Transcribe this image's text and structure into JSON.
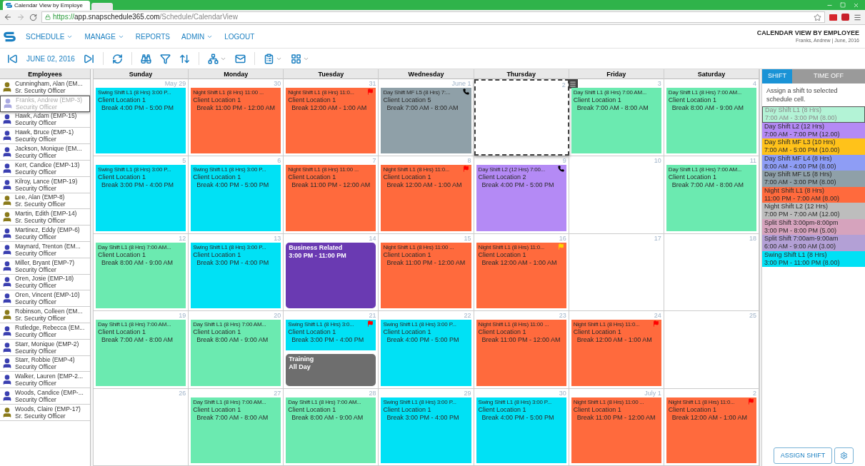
{
  "browser": {
    "tab_title": "Calendar View by Employe",
    "url_scheme": "https://",
    "url_host": "app.snapschedule365.com",
    "url_path": "/Schedule/CalendarView"
  },
  "nav": {
    "menu": [
      {
        "label": "SCHEDULE",
        "dropdown": true
      },
      {
        "label": "MANAGE",
        "dropdown": true
      },
      {
        "label": "REPORTS",
        "dropdown": false
      },
      {
        "label": "ADMIN",
        "dropdown": true
      },
      {
        "label": "LOGOUT",
        "dropdown": false
      }
    ],
    "page_title": "CALENDAR VIEW BY EMPLOYEE",
    "page_subtitle": "Franks, Andrew | June, 2016"
  },
  "toolbar": {
    "date": "JUNE 02, 2016"
  },
  "employees": {
    "title": "Employees",
    "items": [
      {
        "name": "Cunningham, Alan (EM...",
        "role": "Sr. Security Officer",
        "color": "#8a7a1a",
        "selected": false
      },
      {
        "name": "Franks, Andrew (EMP-3)",
        "role": "Security Officer",
        "color": "#a9a9e0",
        "selected": true
      },
      {
        "name": "Hawk, Adam (EMP-15)",
        "role": "Security Officer",
        "color": "#3a3fb0",
        "selected": false
      },
      {
        "name": "Hawk, Bruce (EMP-1)",
        "role": "Security Officer",
        "color": "#3a3fb0",
        "selected": false
      },
      {
        "name": "Jackson, Monique (EM...",
        "role": "Security Officer",
        "color": "#3a3fb0",
        "selected": false
      },
      {
        "name": "Kerr, Candice (EMP-13)",
        "role": "Security Officer",
        "color": "#3a3fb0",
        "selected": false
      },
      {
        "name": "Kilroy, Lance (EMP-19)",
        "role": "Security Officer",
        "color": "#3a3fb0",
        "selected": false
      },
      {
        "name": "Lee, Alan (EMP-8)",
        "role": "Sr. Security Officer",
        "color": "#8a7a1a",
        "selected": false
      },
      {
        "name": "Martin, Edith (EMP-14)",
        "role": "Sr. Security Officer",
        "color": "#8a7a1a",
        "selected": false
      },
      {
        "name": "Martinez, Eddy (EMP-6)",
        "role": "Security Officer",
        "color": "#3a3fb0",
        "selected": false
      },
      {
        "name": "Maynard, Trenton (EM...",
        "role": "Security Officer",
        "color": "#3a3fb0",
        "selected": false
      },
      {
        "name": "Miller, Bryant (EMP-7)",
        "role": "Security Officer",
        "color": "#3a3fb0",
        "selected": false
      },
      {
        "name": "Oren, Josie (EMP-18)",
        "role": "Security Officer",
        "color": "#3a3fb0",
        "selected": false
      },
      {
        "name": "Oren, Vincent (EMP-10)",
        "role": "Security Officer",
        "color": "#3a3fb0",
        "selected": false
      },
      {
        "name": "Robinson, Colleen (EM...",
        "role": "Sr. Security Officer",
        "color": "#8a7a1a",
        "selected": false
      },
      {
        "name": "Rutledge, Rebecca (EM...",
        "role": "Security Officer",
        "color": "#3a3fb0",
        "selected": false
      },
      {
        "name": "Starr, Monique (EMP-2)",
        "role": "Security Officer",
        "color": "#3a3fb0",
        "selected": false
      },
      {
        "name": "Starr, Robbie (EMP-4)",
        "role": "Security Officer",
        "color": "#3a3fb0",
        "selected": false
      },
      {
        "name": "Walker, Lauren (EMP-2...",
        "role": "Security Officer",
        "color": "#3a3fb0",
        "selected": false
      },
      {
        "name": "Woods, Candice (EMP-...",
        "role": "Security Officer",
        "color": "#3a3fb0",
        "selected": false
      },
      {
        "name": "Woods, Claire (EMP-17)",
        "role": "Sr. Security Officer",
        "color": "#8a7a1a",
        "selected": false
      }
    ]
  },
  "calendar": {
    "weekdays": [
      "Sunday",
      "Monday",
      "Tuesday",
      "Wednesday",
      "Thursday",
      "Friday",
      "Saturday"
    ],
    "weeks": [
      [
        {
          "date": "May 29",
          "selected": false,
          "events": [
            {
              "kind": "shift",
              "color": "#00e1f5",
              "title": "Swing Shift L1 (8 Hrs) 3:00 P...",
              "location": "Client Location 1",
              "break": "Break 4:00 PM - 5:00 PM"
            }
          ]
        },
        {
          "date": "30",
          "selected": false,
          "events": [
            {
              "kind": "shift",
              "color": "#ff6a3d",
              "title": "Night Shift L1 (8 Hrs) 11:00 ...",
              "location": "Client Location 1",
              "break": "Break 11:00 PM - 12:00 AM"
            }
          ]
        },
        {
          "date": "31",
          "selected": false,
          "events": [
            {
              "kind": "shift",
              "color": "#ff6a3d",
              "title": "Night Shift L1 (8 Hrs) 11:0...",
              "location": "Client Location 1",
              "break": "Break 12:00 AM - 1:00 AM",
              "marker": {
                "kind": "flag",
                "color": "#ff0000"
              }
            }
          ]
        },
        {
          "date": "June 1",
          "selected": false,
          "events": [
            {
              "kind": "shift",
              "color": "#8fa0a8",
              "title": "Day Shift MF L5 (8 Hrs) 7:...",
              "location": "Client Location 5",
              "break": "Break 7:00 AM - 8:00 AM",
              "marker": {
                "kind": "phone"
              }
            }
          ]
        },
        {
          "date": "2",
          "selected": true
        },
        {
          "date": "3",
          "selected": false,
          "events": [
            {
              "kind": "shift",
              "color": "#6beab0",
              "title": "Day Shift L1 (8 Hrs) 7:00 AM...",
              "location": "Client Location 1",
              "break": "Break 7:00 AM - 8:00 AM"
            }
          ]
        },
        {
          "date": "4",
          "selected": false,
          "events": [
            {
              "kind": "shift",
              "color": "#6beab0",
              "title": "Day Shift L1 (8 Hrs) 7:00 AM...",
              "location": "Client Location 1",
              "break": "Break 8:00 AM - 9:00 AM"
            }
          ]
        }
      ],
      [
        {
          "date": "5",
          "selected": false,
          "events": [
            {
              "kind": "shift",
              "color": "#00e1f5",
              "title": "Swing Shift L1 (8 Hrs) 3:00 P...",
              "location": "Client Location 1",
              "break": "Break 3:00 PM - 4:00 PM"
            }
          ]
        },
        {
          "date": "6",
          "selected": false,
          "events": [
            {
              "kind": "shift",
              "color": "#00e1f5",
              "title": "Swing Shift L1 (8 Hrs) 3:00 P...",
              "location": "Client Location 1",
              "break": "Break 4:00 PM - 5:00 PM"
            }
          ]
        },
        {
          "date": "7",
          "selected": false,
          "events": [
            {
              "kind": "shift",
              "color": "#ff6a3d",
              "title": "Night Shift L1 (8 Hrs) 11:00 ...",
              "location": "Client Location 1",
              "break": "Break 11:00 PM - 12:00 AM"
            }
          ]
        },
        {
          "date": "8",
          "selected": false,
          "events": [
            {
              "kind": "shift",
              "color": "#ff6a3d",
              "title": "Night Shift L1 (8 Hrs) 11:0...",
              "location": "Client Location 1",
              "break": "Break 12:00 AM - 1:00 AM",
              "marker": {
                "kind": "flag",
                "color": "#ff0000"
              }
            }
          ]
        },
        {
          "date": "9",
          "selected": false,
          "events": [
            {
              "kind": "shift",
              "color": "#b48af5",
              "title": "Day Shift L2 (12 Hrs) 7:00...",
              "location": "Client Location 2",
              "break": "Break 4:00 PM - 5:00 PM",
              "marker": {
                "kind": "phone"
              }
            }
          ]
        },
        {
          "date": "10",
          "selected": false
        },
        {
          "date": "11",
          "selected": false,
          "events": [
            {
              "kind": "shift",
              "color": "#6beab0",
              "title": "Day Shift L1 (8 Hrs) 7:00 AM...",
              "location": "Client Location 1",
              "break": "Break 7:00 AM - 8:00 AM"
            }
          ]
        }
      ],
      [
        {
          "date": "12",
          "selected": false,
          "events": [
            {
              "kind": "shift",
              "color": "#6beab0",
              "title": "Day Shift L1 (8 Hrs) 7:00 AM...",
              "location": "Client Location 1",
              "break": "Break 8:00 AM - 9:00 AM"
            }
          ]
        },
        {
          "date": "13",
          "selected": false,
          "events": [
            {
              "kind": "shift",
              "color": "#00e1f5",
              "title": "Swing Shift L1 (8 Hrs) 3:00 P...",
              "location": "Client Location 1",
              "break": "Break 3:00 PM - 4:00 PM"
            }
          ]
        },
        {
          "date": "14",
          "selected": false,
          "events": [
            {
              "kind": "block",
              "color": "#6a3ab2",
              "title": "Business Related",
              "time": "3:00 PM - 11:00 PM"
            }
          ]
        },
        {
          "date": "15",
          "selected": false,
          "events": [
            {
              "kind": "shift",
              "color": "#ff6a3d",
              "title": "Night Shift L1 (8 Hrs) 11:00 ...",
              "location": "Client Location 1",
              "break": "Break 11:00 PM - 12:00 AM"
            }
          ]
        },
        {
          "date": "16",
          "selected": false,
          "events": [
            {
              "kind": "shift",
              "color": "#ff6a3d",
              "title": "Night Shift L1 (8 Hrs) 11:0...",
              "location": "Client Location 1",
              "break": "Break 12:00 AM - 1:00 AM",
              "marker": {
                "kind": "flag",
                "color": "#ffd400"
              }
            }
          ]
        },
        {
          "date": "17",
          "selected": false
        },
        {
          "date": "18",
          "selected": false
        }
      ],
      [
        {
          "date": "19",
          "selected": false,
          "events": [
            {
              "kind": "shift",
              "color": "#6beab0",
              "title": "Day Shift L1 (8 Hrs) 7:00 AM...",
              "location": "Client Location 1",
              "break": "Break 7:00 AM - 8:00 AM"
            }
          ]
        },
        {
          "date": "20",
          "selected": false,
          "events": [
            {
              "kind": "shift",
              "color": "#6beab0",
              "title": "Day Shift L1 (8 Hrs) 7:00 AM...",
              "location": "Client Location 1",
              "break": "Break 8:00 AM - 9:00 AM"
            }
          ]
        },
        {
          "date": "21",
          "selected": false,
          "events": [
            {
              "kind": "shift",
              "color": "#00e1f5",
              "title": "Swing Shift L1 (8 Hrs) 3:0...",
              "location": "Client Location 1",
              "break": "Break 3:00 PM - 4:00 PM",
              "marker": {
                "kind": "flag",
                "color": "#ff0000"
              }
            },
            {
              "kind": "block",
              "color": "#6e6e6e",
              "title": "Training",
              "time": "All Day"
            }
          ]
        },
        {
          "date": "22",
          "selected": false,
          "events": [
            {
              "kind": "shift",
              "color": "#00e1f5",
              "title": "Swing Shift L1 (8 Hrs) 3:00 P...",
              "location": "Client Location 1",
              "break": "Break 4:00 PM - 5:00 PM"
            }
          ]
        },
        {
          "date": "23",
          "selected": false,
          "events": [
            {
              "kind": "shift",
              "color": "#ff6a3d",
              "title": "Night Shift L1 (8 Hrs) 11:00 ...",
              "location": "Client Location 1",
              "break": "Break 11:00 PM - 12:00 AM"
            }
          ]
        },
        {
          "date": "24",
          "selected": false,
          "events": [
            {
              "kind": "shift",
              "color": "#ff6a3d",
              "title": "Night Shift L1 (8 Hrs) 11:0...",
              "location": "Client Location 1",
              "break": "Break 12:00 AM - 1:00 AM",
              "marker": {
                "kind": "flag",
                "color": "#ff0000"
              }
            }
          ]
        },
        {
          "date": "25",
          "selected": false
        }
      ],
      [
        {
          "date": "26",
          "selected": false
        },
        {
          "date": "27",
          "selected": false,
          "events": [
            {
              "kind": "shift",
              "color": "#6beab0",
              "title": "Day Shift L1 (8 Hrs) 7:00 AM...",
              "location": "Client Location 1",
              "break": "Break 7:00 AM - 8:00 AM"
            }
          ]
        },
        {
          "date": "28",
          "selected": false,
          "events": [
            {
              "kind": "shift",
              "color": "#6beab0",
              "title": "Day Shift L1 (8 Hrs) 7:00 AM...",
              "location": "Client Location 1",
              "break": "Break 8:00 AM - 9:00 AM"
            }
          ]
        },
        {
          "date": "29",
          "selected": false,
          "events": [
            {
              "kind": "shift",
              "color": "#00e1f5",
              "title": "Swing Shift L1 (8 Hrs) 3:00 P...",
              "location": "Client Location 1",
              "break": "Break 3:00 PM - 4:00 PM"
            }
          ]
        },
        {
          "date": "30",
          "selected": false,
          "events": [
            {
              "kind": "shift",
              "color": "#00e1f5",
              "title": "Swing Shift L1 (8 Hrs) 3:00 P...",
              "location": "Client Location 1",
              "break": "Break 4:00 PM - 5:00 PM"
            }
          ]
        },
        {
          "date": "July 1",
          "selected": false,
          "events": [
            {
              "kind": "shift",
              "color": "#ff6a3d",
              "title": "Night Shift L1 (8 Hrs) 11:00 ...",
              "location": "Client Location 1",
              "break": "Break 11:00 PM - 12:00 AM"
            }
          ]
        },
        {
          "date": "2",
          "selected": false,
          "events": [
            {
              "kind": "shift",
              "color": "#ff6a3d",
              "title": "Night Shift L1 (8 Hrs) 11:0...",
              "location": "Client Location 1",
              "break": "Break 12:00 AM - 1:00 AM",
              "marker": {
                "kind": "flag",
                "color": "#ff0000"
              }
            }
          ]
        }
      ]
    ]
  },
  "panel": {
    "tabs": [
      {
        "label": "SHIFT",
        "selected": true
      },
      {
        "label": "TIME OFF",
        "selected": false
      }
    ],
    "hint": "Assign a shift to selected schedule cell.",
    "shifts": [
      {
        "name": "Day Shift L1 (8 Hrs)",
        "time": "7:00 AM - 3:00 PM (8.00)",
        "color": "#b3f3d6",
        "selected": true
      },
      {
        "name": "Day Shift L2 (12 Hrs)",
        "time": "7:00 AM - 7:00 PM (12.00)",
        "color": "#b48af5",
        "selected": false
      },
      {
        "name": "Day Shift MF L3 (10 Hrs)",
        "time": "7:00 AM - 5:00 PM (10.00)",
        "color": "#ffc21a",
        "selected": false
      },
      {
        "name": "Day Shift MF L4 (8 Hrs)",
        "time": "8:00 AM - 4:00 PM (8.00)",
        "color": "#8e9df5",
        "selected": false
      },
      {
        "name": "Day Shift MF L5 (8 Hrs)",
        "time": "7:00 AM - 3:00 PM (8.00)",
        "color": "#8fa0a8",
        "selected": false
      },
      {
        "name": "Night Shift L1 (8 Hrs)",
        "time": "11:00 PM - 7:00 AM (8.00)",
        "color": "#ff6a3d",
        "selected": false
      },
      {
        "name": "Night Shift L2 (12 Hrs)",
        "time": "7:00 PM - 7:00 AM (12.00)",
        "color": "#bdbdbd",
        "selected": false
      },
      {
        "name": "Split Shift 3:00pm-8:00pm",
        "time": "3:00 PM - 8:00 PM (5.00)",
        "color": "#d6a3bd",
        "selected": false
      },
      {
        "name": "Split Shift 7:00am-9:00am",
        "time": "6:00 AM - 9:00 AM (3.00)",
        "color": "#b3a0d6",
        "selected": false
      },
      {
        "name": "Swing Shift L1 (8 Hrs)",
        "time": "3:00 PM - 11:00 PM (8.00)",
        "color": "#00e1f5",
        "selected": false
      }
    ],
    "assign_button": "ASSIGN SHIFT"
  }
}
